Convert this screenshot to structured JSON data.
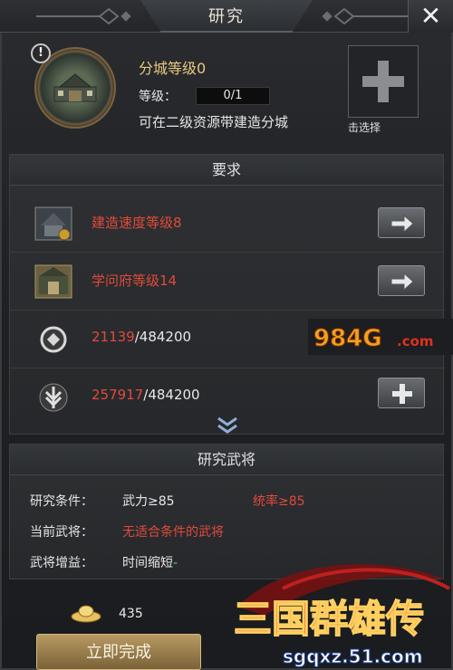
{
  "window": {
    "title": "研究",
    "close_glyph": "✕"
  },
  "header": {
    "name": "分城等级0",
    "level_label": "等级：",
    "level_value": "0/1",
    "description": "可在二级资源带建造分城",
    "alert_glyph": "!"
  },
  "requirements": {
    "title": "要求",
    "items": [
      {
        "icon": "speed-building-icon",
        "text": "建造速度等级8",
        "button": "arrow-right-icon"
      },
      {
        "icon": "academy-building-icon",
        "text": "学问府等级14",
        "button": "arrow-right-icon"
      },
      {
        "icon": "coin-icon",
        "current": "21139",
        "total": "/484200",
        "button": "plus-icon"
      },
      {
        "icon": "grain-icon",
        "current": "257917",
        "total": "/484200",
        "button": "plus-icon"
      }
    ],
    "more_icon": "double-chevron-down-icon"
  },
  "generals": {
    "title": "研究武将",
    "condition_label": "研究条件：",
    "condition_1": "武力≥85",
    "condition_2": "统率≥85",
    "current_label": "当前武将：",
    "current_value": "无适合条件的武将",
    "bonus_label": "武将增益：",
    "bonus_value": "时间缩短",
    "bonus_suffix": "-",
    "select_label": "击选择"
  },
  "cost": {
    "icon": "gold-ingot-icon",
    "value": "435"
  },
  "actions": {
    "finish_label": "立即完成"
  },
  "watermarks": {
    "site_badge": "984G.com",
    "game_title": "三国群雄传",
    "game_url": "sgqxz.51.com"
  },
  "colors": {
    "accent_gold": "#e9c97e",
    "requirement_red": "#e24a3a",
    "text_light": "#e6e6e6",
    "bonus_green": "#5fcf5f"
  }
}
